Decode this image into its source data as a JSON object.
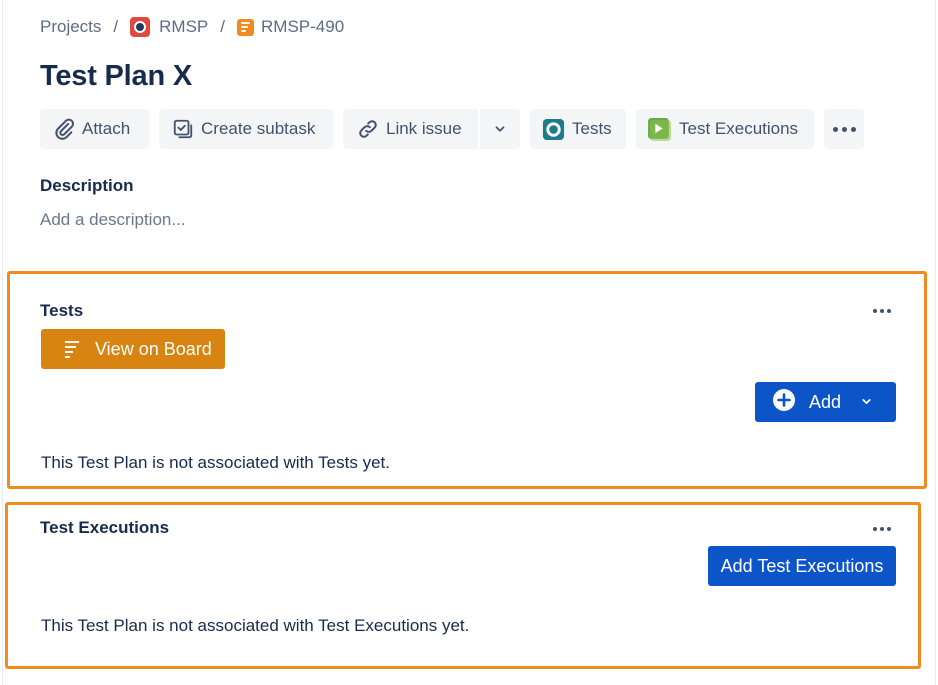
{
  "breadcrumb": {
    "projects": "Projects",
    "separator": "/",
    "project": "RMSP",
    "issue_key": "RMSP-490"
  },
  "issue": {
    "title": "Test Plan X"
  },
  "toolbar": {
    "attach": "Attach",
    "create_subtask": "Create subtask",
    "link_issue": "Link issue",
    "tests": "Tests",
    "test_executions": "Test Executions"
  },
  "description": {
    "label": "Description",
    "placeholder": "Add a description..."
  },
  "tests_panel": {
    "title": "Tests",
    "view_on_board": "View on Board",
    "add": "Add",
    "empty_message": "This Test Plan is not associated with Tests yet."
  },
  "executions_panel": {
    "title": "Test Executions",
    "add_button": "Add Test Executions",
    "empty_message": "This Test Plan is not associated with Test Executions yet."
  },
  "colors": {
    "highlight_border": "#f28b1f",
    "view_board_bg": "#d88413",
    "primary_button": "#0c55c8",
    "toolbar_button_bg": "#f4f5f7",
    "text_dark": "#172b4d",
    "text_subtle": "#5e6c84"
  },
  "icons": {
    "attach": "paperclip-icon",
    "create_subtask": "subtask-checkbox-icon",
    "link_issue": "link-icon",
    "dropdown": "chevron-down-icon",
    "tests": "xray-tests-icon",
    "test_executions": "xray-executions-icon",
    "more": "more-horizontal-icon",
    "view_board": "board-lines-icon",
    "add": "plus-circle-icon"
  }
}
